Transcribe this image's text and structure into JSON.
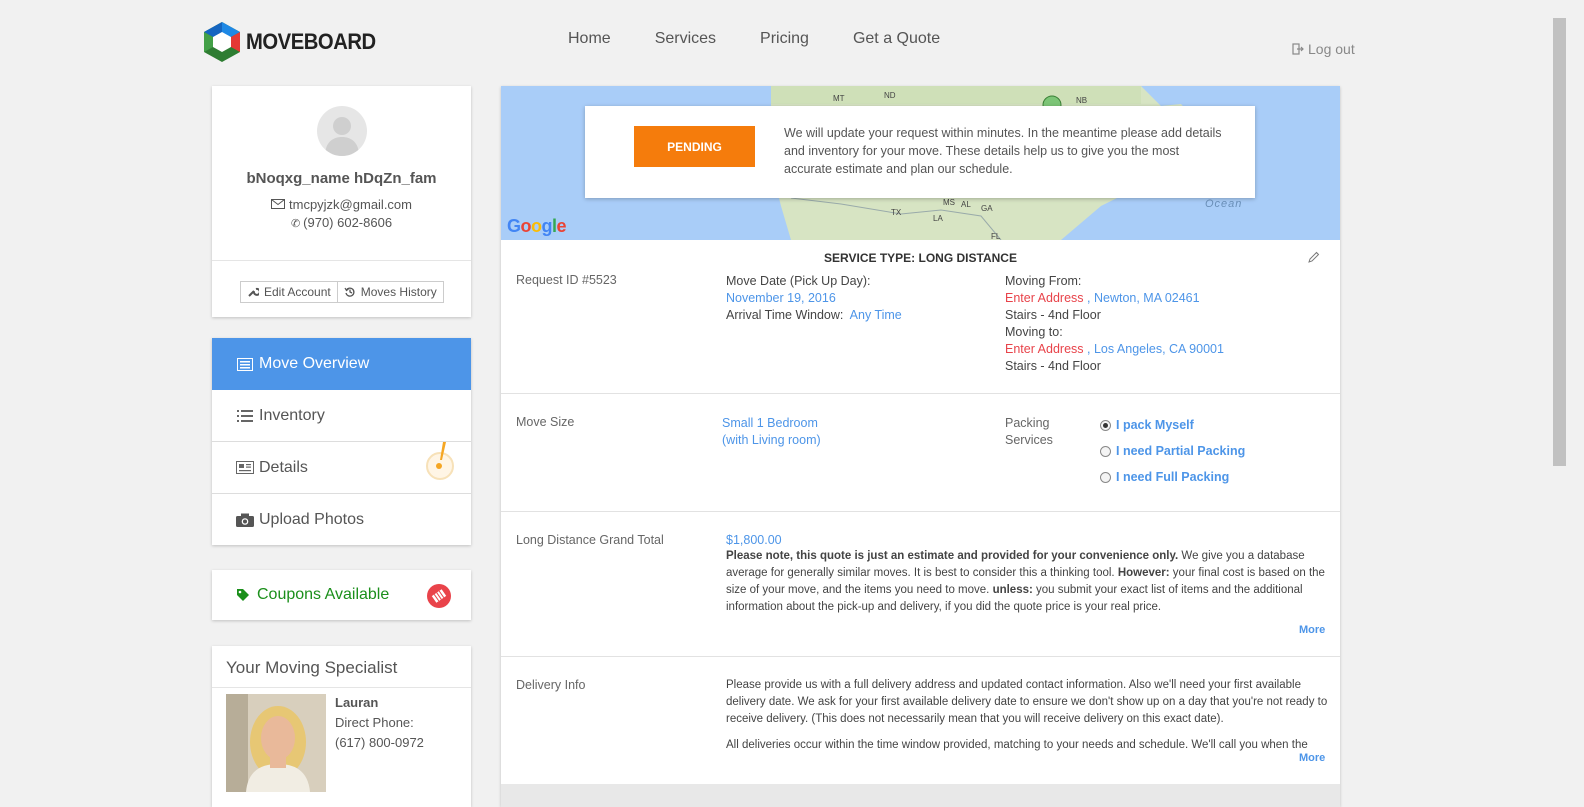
{
  "header": {
    "logo_text": "MOVEBOARD",
    "nav": [
      "Home",
      "Services",
      "Pricing",
      "Get a Quote"
    ],
    "logout": "Log out"
  },
  "profile": {
    "name": "bNoqxg_name hDqZn_fam",
    "email": "tmcpyjzk@gmail.com",
    "phone": "(970) 602-8606",
    "edit_account": "Edit Account",
    "moves_history": "Moves History"
  },
  "menu": {
    "items": [
      "Move Overview",
      "Inventory",
      "Details",
      "Upload Photos"
    ],
    "active": "Move Overview"
  },
  "coupons": {
    "label": "Coupons Available"
  },
  "specialist": {
    "title": "Your Moving Specialist",
    "name": "Lauran",
    "phone_label": "Direct Phone:",
    "phone": "(617) 800-0972"
  },
  "notice": {
    "status": "PENDING",
    "text": "We will update your request within minutes. In the meantime please add details and inventory for your move. These details help us to give you the most accurate estimate and plan our schedule."
  },
  "map": {
    "provider": "Google",
    "labels": [
      "MT",
      "ND",
      "NB",
      "TX",
      "LA",
      "MS",
      "AL",
      "GA",
      "FL",
      "Ocean"
    ]
  },
  "service": {
    "title": "SERVICE TYPE: LONG DISTANCE",
    "request_id": "Request ID #5523",
    "move_date_label": "Move Date (Pick Up Day):",
    "move_date": "November 19, 2016",
    "arrival_label": "Arrival Time Window:",
    "arrival": "Any Time",
    "moving_from_label": "Moving From:",
    "from_enter": "Enter Address",
    "from_city": "Newton, MA 02461",
    "from_stairs": "Stairs - 4nd Floor",
    "moving_to_label": "Moving to:",
    "to_enter": "Enter Address",
    "to_city": "Los Angeles, CA 90001",
    "to_stairs": "Stairs - 4nd Floor"
  },
  "move_size": {
    "label": "Move Size",
    "value_line1": "Small 1 Bedroom",
    "value_line2": "(with Living room)",
    "packing_label_1": "Packing",
    "packing_label_2": "Services",
    "options": [
      "I pack Myself",
      "I need Partial Packing",
      "I need Full Packing"
    ],
    "selected": "I pack Myself"
  },
  "grand_total": {
    "label": "Long Distance Grand Total",
    "amount": "$1,800.00",
    "p_bold1": "Please note, this quote is just an estimate and provided for your convenience only.",
    "p_text1": " We give you a database average for generally similar moves. It is best to consider this a thinking tool. ",
    "p_bold2": "However:",
    "p_text2": " your final cost is based on the size of your move, and the items you need to move. ",
    "p_bold3": "unless:",
    "p_text3": " you submit your exact list of items and the additional information about the pick-up and delivery, if you did the quote price is your real price.",
    "more": "More"
  },
  "delivery": {
    "label": "Delivery Info",
    "p1": "Please provide us with a full delivery address and updated contact information. Also we'll need your first available delivery date. We ask for your first available delivery date to ensure we don't show up on a day that you're not ready to receive delivery. (This does not necessarily mean that you will receive delivery on this exact date).",
    "p2": "All deliveries occur within the time window provided, matching to your needs and schedule. We'll call you when the",
    "more": "More"
  }
}
